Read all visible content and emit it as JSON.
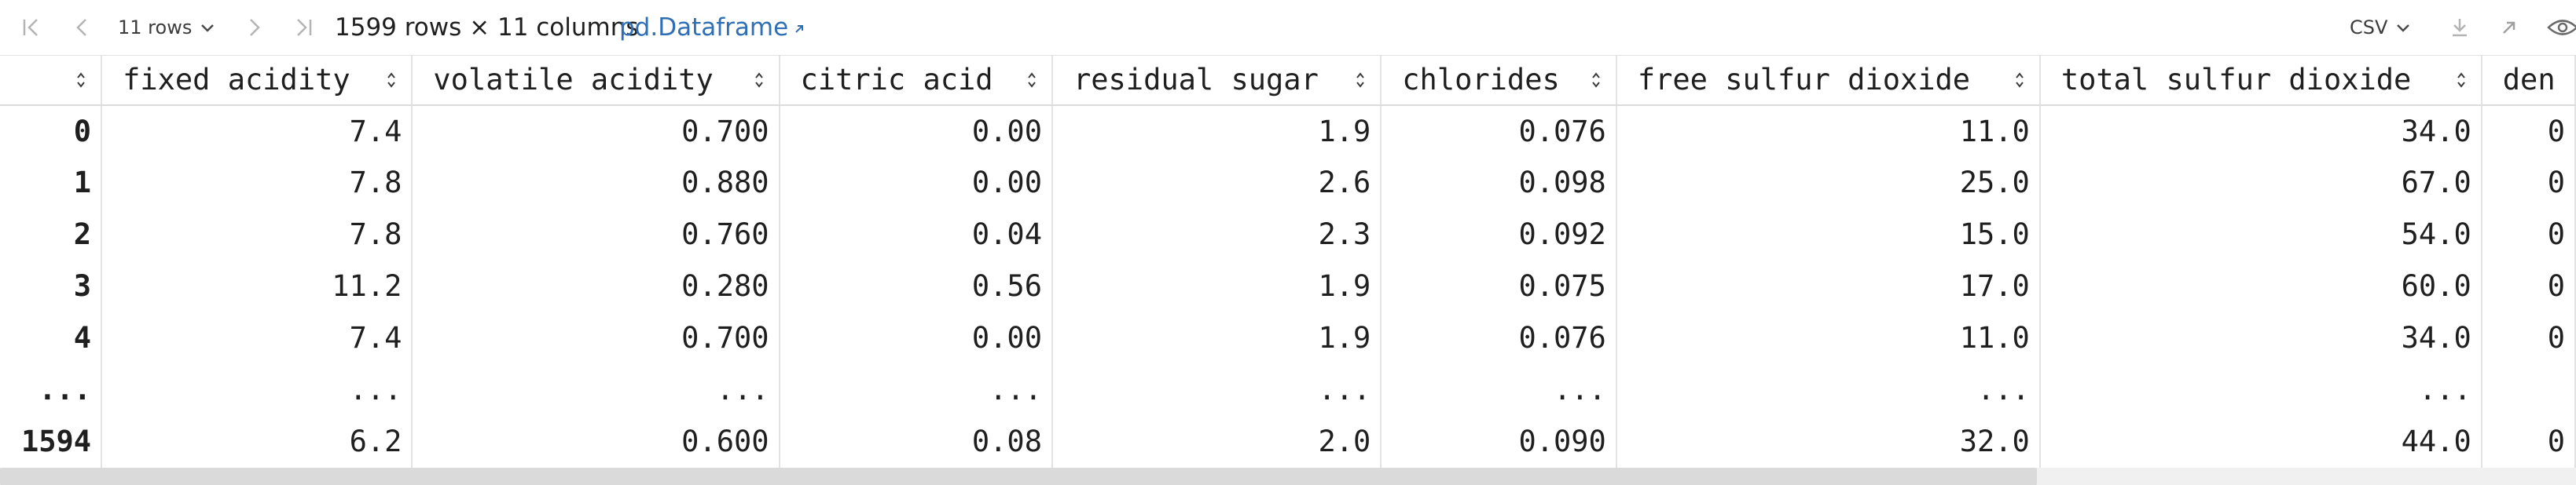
{
  "toolbar": {
    "rows_label": "11 rows",
    "summary": "1599 rows × 11 columns",
    "link_label": "pd.Dataframe",
    "format_label": "CSV"
  },
  "table": {
    "columns": [
      "fixed acidity",
      "volatile acidity",
      "citric acid",
      "residual sugar",
      "chlorides",
      "free sulfur dioxide",
      "total sulfur dioxide",
      "den"
    ],
    "rows": [
      {
        "index": "0",
        "cells": [
          "7.4",
          "0.700",
          "0.00",
          "1.9",
          "0.076",
          "11.0",
          "34.0",
          "0"
        ]
      },
      {
        "index": "1",
        "cells": [
          "7.8",
          "0.880",
          "0.00",
          "2.6",
          "0.098",
          "25.0",
          "67.0",
          "0"
        ]
      },
      {
        "index": "2",
        "cells": [
          "7.8",
          "0.760",
          "0.04",
          "2.3",
          "0.092",
          "15.0",
          "54.0",
          "0"
        ]
      },
      {
        "index": "3",
        "cells": [
          "11.2",
          "0.280",
          "0.56",
          "1.9",
          "0.075",
          "17.0",
          "60.0",
          "0"
        ]
      },
      {
        "index": "4",
        "cells": [
          "7.4",
          "0.700",
          "0.00",
          "1.9",
          "0.076",
          "11.0",
          "34.0",
          "0"
        ]
      },
      {
        "index": "...",
        "cells": [
          "...",
          "...",
          "...",
          "...",
          "...",
          "...",
          "...",
          ""
        ]
      },
      {
        "index": "1594",
        "cells": [
          "6.2",
          "0.600",
          "0.08",
          "2.0",
          "0.090",
          "32.0",
          "44.0",
          "0"
        ]
      }
    ]
  },
  "icons": {
    "first": "first-page-icon",
    "prev": "previous-page-icon",
    "next": "next-page-icon",
    "last": "last-page-icon",
    "download": "download-icon",
    "open": "open-external-icon",
    "view": "eye-icon"
  },
  "colors": {
    "link": "#2f6fb5",
    "icon_disabled": "#b4b4b4",
    "grid": "#e3e3e3",
    "scroll_track": "#f0f0f0",
    "scroll_thumb": "#dadada"
  }
}
